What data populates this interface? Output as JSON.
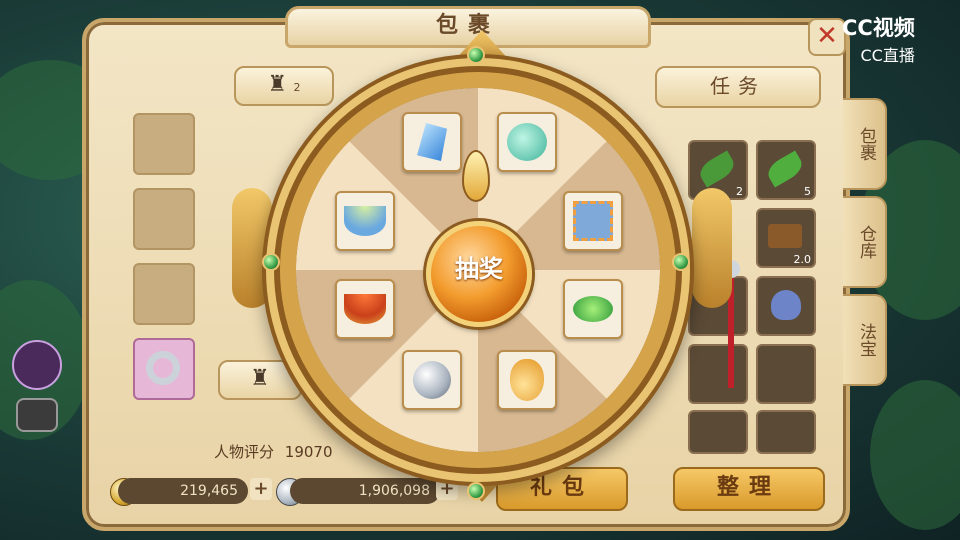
{
  "window": {
    "title": "包裹"
  },
  "top_tabs": {
    "char_badge": "2",
    "tasks": "任务"
  },
  "side_tabs": [
    "包裹",
    "仓库",
    "法宝"
  ],
  "wheel": {
    "draw_label": "抽奖"
  },
  "prizes": [
    {
      "icon": "blue-crystal-icon"
    },
    {
      "icon": "spirit-pet-icon"
    },
    {
      "icon": "stamp-card-icon"
    },
    {
      "icon": "green-peas-icon"
    },
    {
      "icon": "gourd-icon"
    },
    {
      "icon": "silver-coin-icon"
    },
    {
      "icon": "tomato-soup-bowl-icon"
    },
    {
      "icon": "green-soup-bowl-icon"
    }
  ],
  "inventory": {
    "counts": [
      "2",
      "5",
      "2.0"
    ]
  },
  "stats": {
    "rating_label": "人物评分",
    "rating_value": "19070"
  },
  "currency": {
    "gold": "219,465",
    "silver": "1,906,098"
  },
  "buttons": {
    "gift": "礼包",
    "sort": "整理"
  },
  "watermark": {
    "line1": "CC视频",
    "line2": "CC直播"
  },
  "colors": {
    "accent": "#d99a2b",
    "frame_gold": "#d5a44a",
    "panel": "#f3e6c6"
  }
}
